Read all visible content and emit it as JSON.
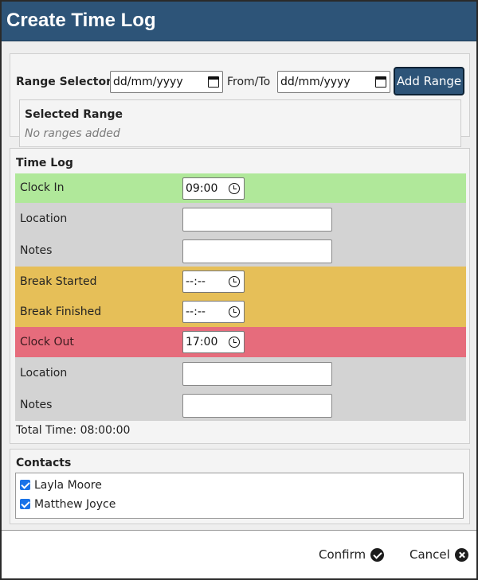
{
  "dialog": {
    "title": "Create Time Log"
  },
  "range": {
    "selector_label": "Range Selector",
    "from_placeholder": "dd/mm/yyyy",
    "from_to_label": "From/To",
    "to_placeholder": "dd/mm/yyyy",
    "add_button": "Add Range",
    "selected_title": "Selected Range",
    "empty_text": "No ranges added"
  },
  "timelog": {
    "title": "Time Log",
    "clock_in": {
      "label": "Clock In",
      "value": "09:00"
    },
    "location_1": {
      "label": "Location",
      "value": ""
    },
    "notes_1": {
      "label": "Notes",
      "value": ""
    },
    "break_started": {
      "label": "Break Started",
      "value": "--:--"
    },
    "break_finished": {
      "label": "Break Finished",
      "value": "--:--"
    },
    "clock_out": {
      "label": "Clock Out",
      "value": "17:00"
    },
    "location_2": {
      "label": "Location",
      "value": ""
    },
    "notes_2": {
      "label": "Notes",
      "value": ""
    },
    "total_time": "Total Time: 08:00:00",
    "colors": {
      "clock_in": "#b0e89a",
      "neutral": "#d3d3d3",
      "break": "#e6bf58",
      "clock_out": "#e66c7c"
    }
  },
  "contacts": {
    "title": "Contacts",
    "items": [
      {
        "name": "Layla Moore",
        "checked": true
      },
      {
        "name": "Matthew Joyce",
        "checked": true
      }
    ]
  },
  "footer": {
    "confirm": "Confirm",
    "cancel": "Cancel"
  },
  "icons": {
    "calendar": "calendar-icon",
    "clock": "clock-icon",
    "confirm": "check-circle-icon",
    "cancel": "close-circle-icon"
  },
  "theme": {
    "header": "#2d5478"
  }
}
